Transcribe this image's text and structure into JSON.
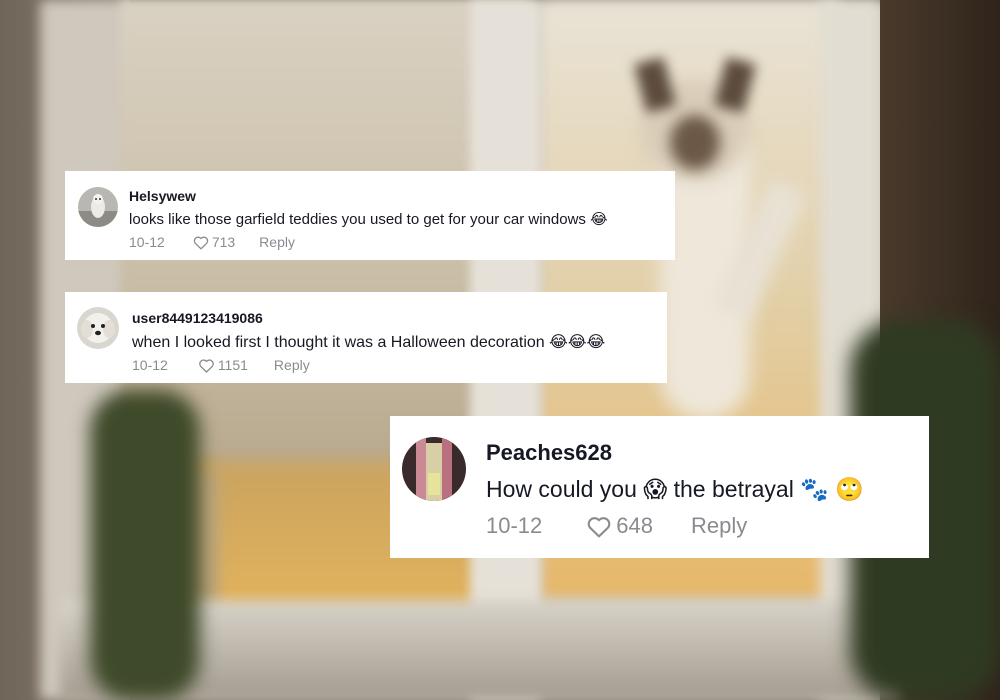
{
  "comments": [
    {
      "username": "Helsywew",
      "text": "looks like those garfield teddies you used to get for your car windows",
      "emojis": [
        "😂"
      ],
      "date": "10-12",
      "likes": "713",
      "reply_label": "Reply",
      "avatar_icon": "dog-photo-avatar"
    },
    {
      "username": "user8449123419086",
      "text": "when I looked first I thought it was a Halloween decoration",
      "emojis": [
        "😂",
        "😂",
        "😂"
      ],
      "date": "10-12",
      "likes": "1151",
      "reply_label": "Reply",
      "avatar_icon": "white-dog-avatar"
    },
    {
      "username": "Peaches628",
      "text_before": "How could you",
      "emoji_mid": "😱",
      "text_after": "the betrayal",
      "emojis_end": [
        "🐾",
        "🙄"
      ],
      "date": "10-12",
      "likes": "648",
      "reply_label": "Reply",
      "avatar_icon": "curtain-photo-avatar"
    }
  ],
  "icons": {
    "like": "heart-outline-icon"
  },
  "colors": {
    "card_bg": "#ffffff",
    "text": "#161823",
    "meta": "#8a8b91"
  }
}
